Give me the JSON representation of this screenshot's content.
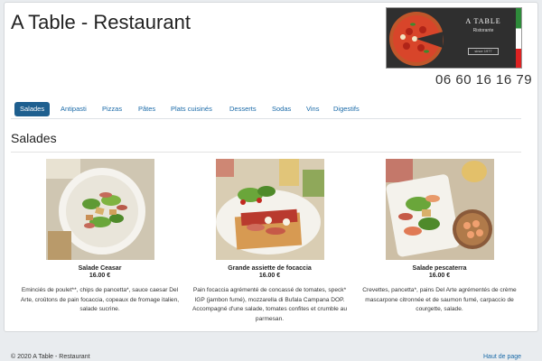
{
  "header": {
    "title": "A Table - Restaurant",
    "phone": "06 60 16 16 79"
  },
  "logo": {
    "brand": "A TABLE",
    "subtitle": "Ristorante",
    "badge": "since 1977"
  },
  "nav": {
    "tabs": [
      {
        "label": "Salades",
        "active": true
      },
      {
        "label": "Antipasti"
      },
      {
        "label": "Pizzas"
      },
      {
        "label": "Pâtes"
      },
      {
        "label": "Plats cuisinés"
      },
      {
        "label": "Desserts"
      },
      {
        "label": "Sodas"
      },
      {
        "label": "Vins"
      },
      {
        "label": "Digestifs"
      }
    ]
  },
  "section": {
    "title": "Salades"
  },
  "items": [
    {
      "name": "Salade Ceasar",
      "price": "16.00 €",
      "description": "Eminciés de poulet**, chips de pancetta*, sauce caesar Del Arte, croûtons de pain focaccia, copeaux de fromage italien, salade sucrine."
    },
    {
      "name": "Grande assiette de focaccia",
      "price": "16.00 €",
      "description": "Pain focaccia agrémenté de concassé de tomates, speck* IGP (jambon fumé), mozzarella di Bufala Campana DOP. Accompagné d'une salade, tomates confites et crumble au parmesan."
    },
    {
      "name": "Salade pescaterra",
      "price": "16.00 €",
      "description": "Crevettes, pancetta*, pains Del Arte agrémentés de crème mascarpone citronnée et de saumon fumé, carpaccio de courgette, salade."
    }
  ],
  "footer": {
    "copyright": "© 2020 A Table - Restaurant",
    "back_to_top": "Haut de page"
  }
}
